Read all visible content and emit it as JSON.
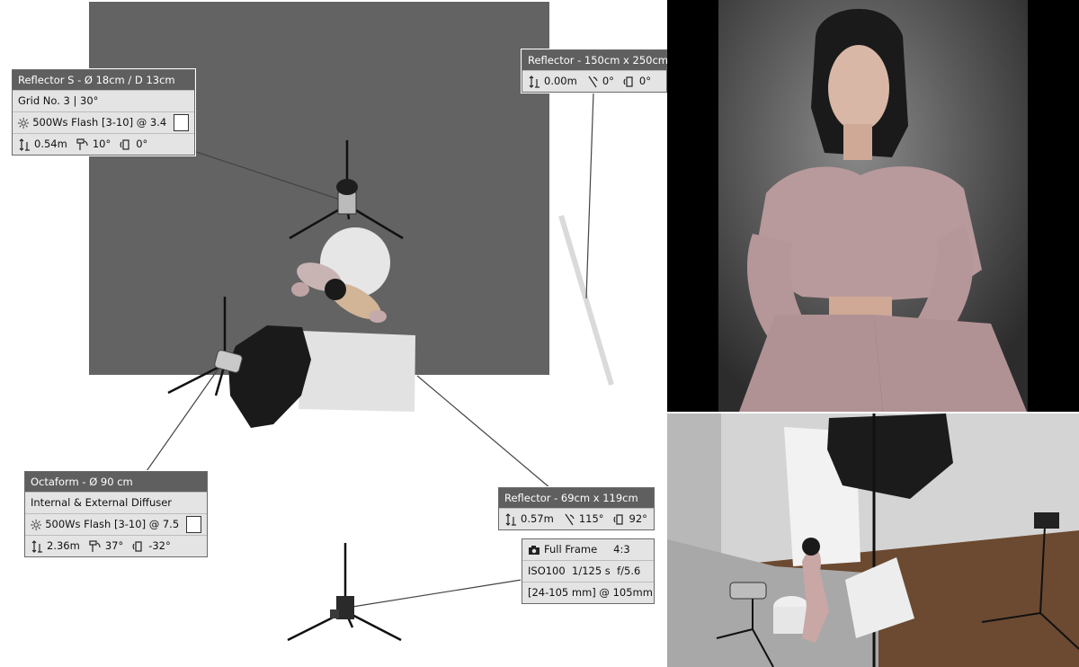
{
  "diagram": {
    "background_color": "#636363",
    "labels": {
      "reflector_s": {
        "title": "Reflector S - Ø 18cm / D 13cm",
        "modifier": "Grid No. 3 | 30°",
        "flash": "500Ws Flash [3-10] @ 3.4",
        "height": "0.54m",
        "tilt": "10°",
        "rotation": "0°"
      },
      "reflector_large": {
        "title": "Reflector - 150cm x 250cm",
        "height": "0.00m",
        "tilt": "0°",
        "rotation": "0°"
      },
      "octaform": {
        "title": "Octaform - Ø 90 cm",
        "modifier": "Internal & External Diffuser",
        "flash": "500Ws Flash [3-10] @ 7.5",
        "height": "2.36m",
        "tilt": "37°",
        "rotation": "-32°"
      },
      "reflector_small": {
        "title": "Reflector - 69cm x 119cm",
        "height": "0.57m",
        "tilt": "115°",
        "rotation": "92°"
      },
      "camera": {
        "format": "Full Frame",
        "ratio": "4:3",
        "settings": "ISO100  1/125 s  f/5.6",
        "lens": "[24-105 mm] @ 105mm"
      }
    }
  }
}
